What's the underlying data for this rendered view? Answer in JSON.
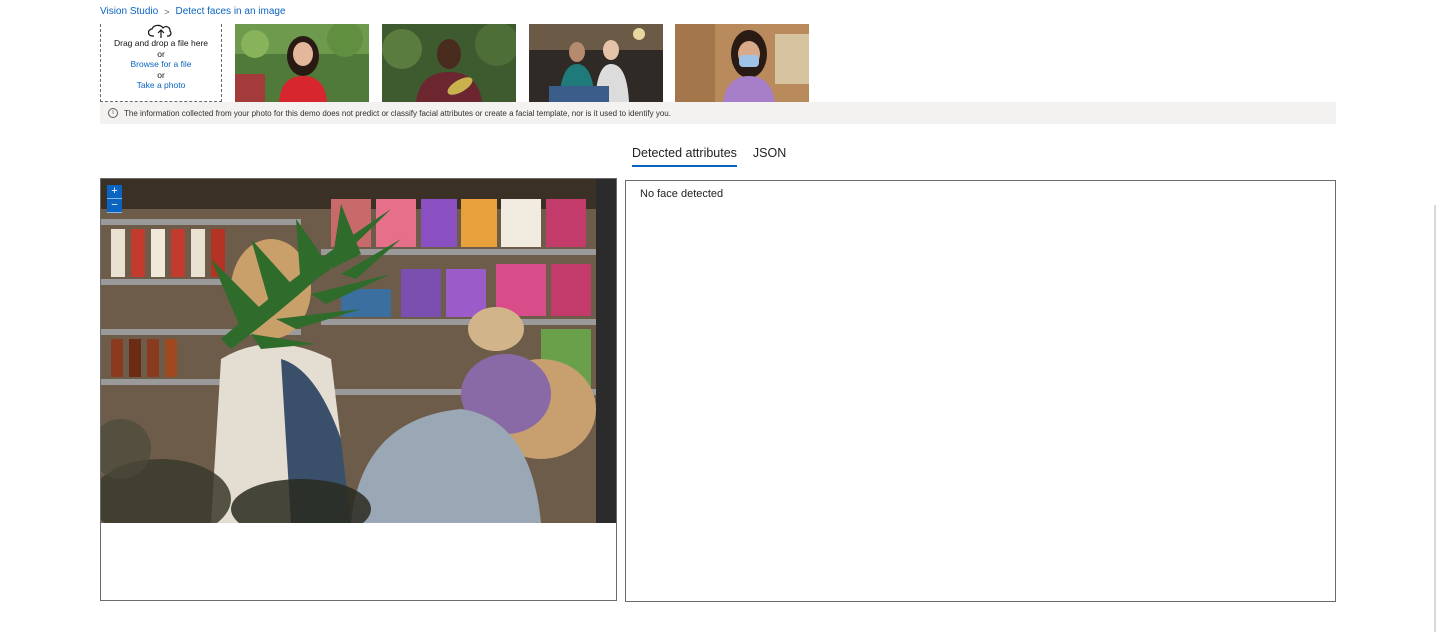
{
  "breadcrumb": {
    "root": "Vision Studio",
    "separator": ">",
    "current": "Detect faces in an image"
  },
  "upload": {
    "icon": "cloud-upload-icon",
    "drag_text": "Drag and drop a file here",
    "or1": "or",
    "browse": "Browse for a file",
    "or2": "or",
    "take_photo": "Take a photo"
  },
  "samples": [
    {
      "icon": "sample-woman-red-top"
    },
    {
      "icon": "sample-man-burgundy-shirt"
    },
    {
      "icon": "sample-two-women-seated"
    },
    {
      "icon": "sample-woman-face-mask"
    }
  ],
  "notice": {
    "icon": "info-icon",
    "text": "The information collected from your photo for this demo does not predict or classify facial attributes or create a facial template, nor is it used to identify you."
  },
  "tabs": {
    "detected": "Detected attributes",
    "json": "JSON",
    "active": "Detected attributes"
  },
  "viewer": {
    "zoom_in": "+",
    "zoom_out": "−"
  },
  "results": {
    "message": "No face detected"
  },
  "colors": {
    "accent": "#0a64c2",
    "notice_bg": "#f3f2f1",
    "border": "#6b6b6b"
  }
}
